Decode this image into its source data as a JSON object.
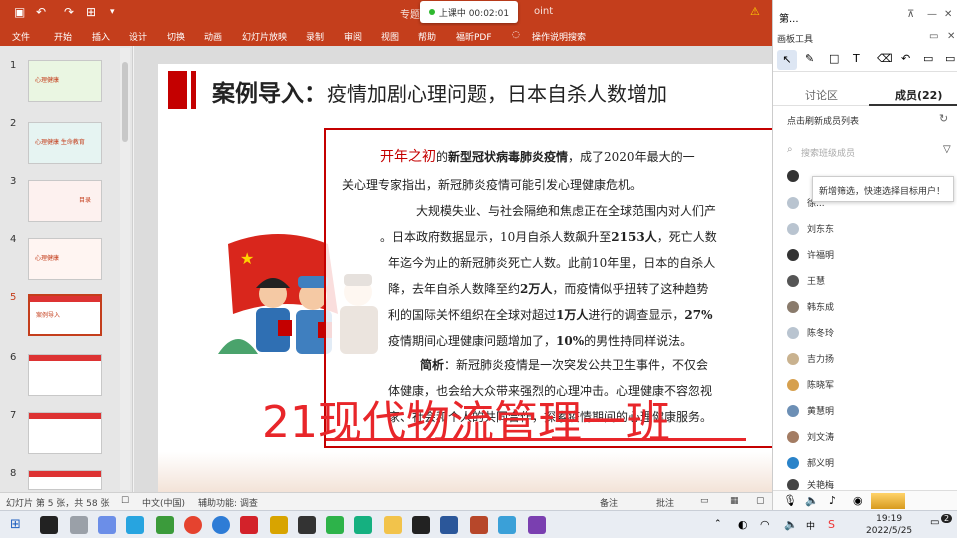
{
  "titlebar": {
    "title_left": "专题",
    "title_right": "oint",
    "warn": "⚠"
  },
  "recording": {
    "label": "上课中 00:02:01"
  },
  "menu": [
    "文件",
    "开始",
    "插入",
    "设计",
    "切换",
    "动画",
    "幻灯片放映",
    "录制",
    "审阅",
    "视图",
    "帮助",
    "福昕PDF",
    "操作说明搜索"
  ],
  "thumbnails": [
    {
      "num": "1",
      "label": "心理健康"
    },
    {
      "num": "2",
      "label": "心理健康 生命教育"
    },
    {
      "num": "3",
      "label": "目录"
    },
    {
      "num": "4",
      "label": "心理健康"
    },
    {
      "num": "5",
      "label": "案例导入"
    },
    {
      "num": "6",
      "label": ""
    },
    {
      "num": "7",
      "label": ""
    },
    {
      "num": "8",
      "label": ""
    }
  ],
  "slide": {
    "title": "案例导入：",
    "subtitle": "疫情加剧心理问题，日本自杀人数增加",
    "p1_red": "开年之初",
    "p1a": "的",
    "p1b": "新型冠状病毒肺炎疫情",
    "p1c": "，成了2020年最大的一",
    "p2": "关心理专家指出，新冠肺炎疫情可能引发心理健康危机。",
    "p3": "大规模失业、与社会隔绝和焦虑正在全球范围内对人们产",
    "p4a": "。日本政府数据显示，10月自杀人数飙升至",
    "p4b": "2153人",
    "p4c": "，死亡人数",
    "p5": "年迄今为止的新冠肺炎死亡人数。此前10年里，日本的自杀人",
    "p6a": "降，去年自杀人数降至约",
    "p6b": "2万人",
    "p6c": "，而疫情似乎扭转了这种趋势",
    "p7a": "利的国际关怀组织在全球对超过",
    "p7b": "1万人",
    "p7c": "进行的调查显示，",
    "p7d": "27%",
    "p8a": "疫情期间心理健康问题增加了，",
    "p8b": "10%",
    "p8c": "的男性持同样说法。",
    "p9a": "简析",
    "p9b": "：新冠肺炎疫情是一次突发公共卫生事件，不仅会",
    "p10": "体健康，也会给大众带来强烈的心理冲击。心理健康不容忽视",
    "p11": "家、社会和个人的共同合作，探索疫情期间的心理健康服务。",
    "overlay": "21现代物流管理一班"
  },
  "status": {
    "slide_info": "幻灯片 第 5 张，共 58 张",
    "lang": "中文(中国)",
    "access": "辅助功能: 调查",
    "notes": "备注",
    "comments": "批注"
  },
  "panel": {
    "title": "第...",
    "toolbar_label": "画板工具",
    "tab_discuss": "讨论区",
    "tab_members": "成员(22)",
    "roster": "点击刷新成员列表",
    "search_placeholder": "搜索班级成员",
    "tip": "新增筛选，快速选择目标用户！",
    "members": [
      "",
      "徐...",
      "刘东东",
      "许福明",
      "王慧",
      "韩东成",
      "陈冬玲",
      "吉力扬",
      "陈晓军",
      "黄慧明",
      "刘文涛",
      "郝义明",
      "关艳梅"
    ]
  },
  "taskbar": {
    "time": "19:19",
    "date": "2022/5/25",
    "ime": "中",
    "badge": "2"
  }
}
